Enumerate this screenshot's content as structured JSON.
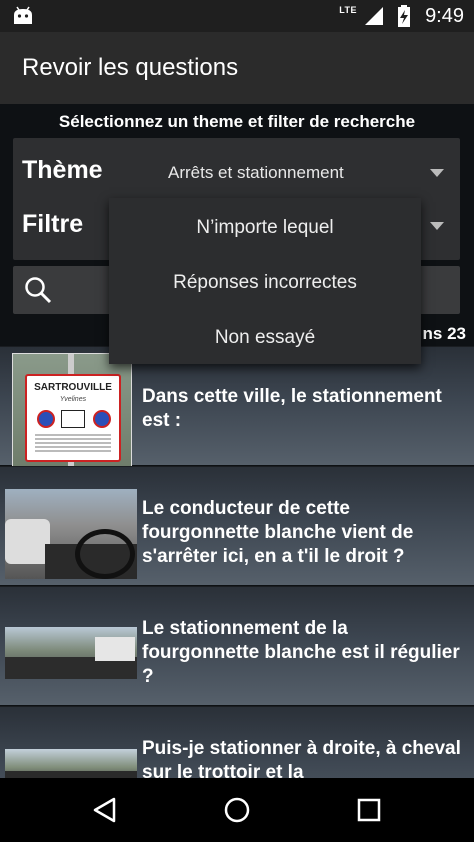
{
  "status_bar": {
    "network": "LTE",
    "time": "9:49"
  },
  "app_bar": {
    "title": "Revoir les questions"
  },
  "filters": {
    "instruction": "Sélectionnez un theme et filter de recherche",
    "theme_label": "Thème",
    "theme_value": "Arrêts et stationnement",
    "filter_label": "Filtre",
    "count_suffix": "ns 23"
  },
  "dropdown": {
    "options": [
      "N’importe lequel",
      "Réponses incorrectes",
      "Non essayé"
    ]
  },
  "questions": [
    {
      "text": "Dans cette ville, le stationnement est :",
      "sign_town": "SARTROUVILLE",
      "sign_sub": "Yvelines"
    },
    {
      "text": "Le conducteur de cette fourgonnette blanche vient de s'arrêter ici, en a t'il le droit ?"
    },
    {
      "text": "Le stationnement de la fourgonnette blanche est il régulier ?"
    },
    {
      "text": "Puis-je stationner à droite, à cheval sur le trottoir et la"
    }
  ],
  "icons": {
    "android": "android-icon",
    "signal": "signal-icon",
    "battery": "battery-charging-icon",
    "search": "search-icon",
    "back": "back-triangle-icon",
    "home": "home-circle-icon",
    "recents": "recents-square-icon"
  }
}
